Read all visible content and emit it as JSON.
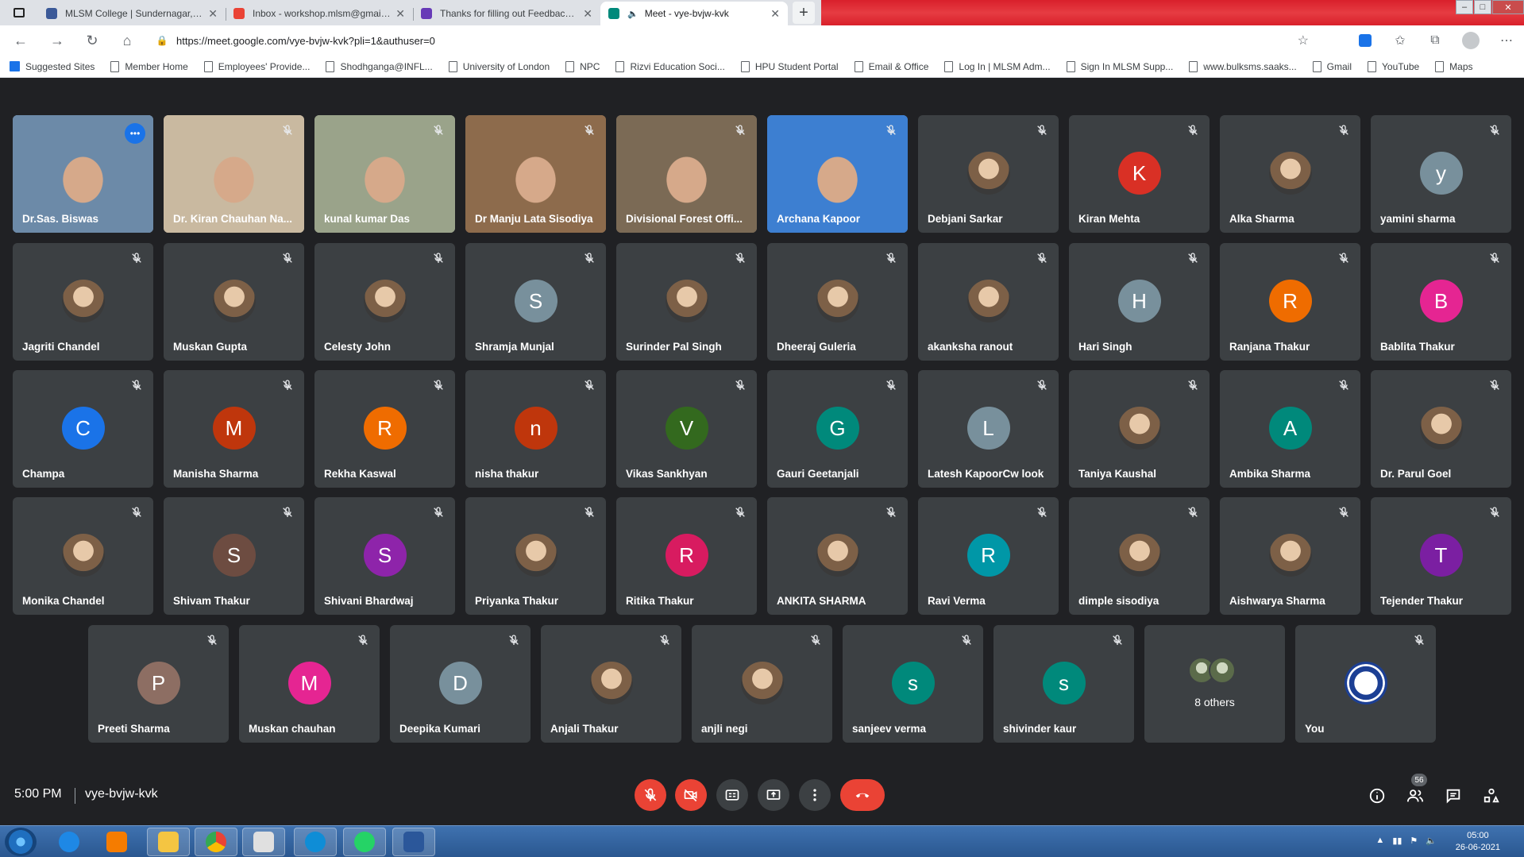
{
  "tabs": [
    {
      "title": "MLSM College | Sundernagar, Mandi",
      "favicon_color": "#3b5998",
      "active": false
    },
    {
      "title": "Inbox - workshop.mlsm@gmail.com",
      "favicon_color": "#ea4335",
      "active": false
    },
    {
      "title": "Thanks for filling out Feedback form",
      "favicon_color": "#673ab7",
      "active": false
    },
    {
      "title": "Meet - vye-bvjw-kvk",
      "favicon_color": "#00897b",
      "active": true
    }
  ],
  "address": {
    "url": "https://meet.google.com/vye-bvjw-kvk?pli=1&authuser=0"
  },
  "bookmarks": [
    {
      "label": "Suggested Sites",
      "icon": "apps-icon"
    },
    {
      "label": "Member Home",
      "icon": "page-icon"
    },
    {
      "label": "Employees' Provide...",
      "icon": "page-icon"
    },
    {
      "label": "Shodhganga@INFL...",
      "icon": "page-icon"
    },
    {
      "label": "University of London",
      "icon": "page-icon"
    },
    {
      "label": "NPC",
      "icon": "page-icon"
    },
    {
      "label": "Rizvi Education Soci...",
      "icon": "page-icon"
    },
    {
      "label": "HPU Student Portal",
      "icon": "page-icon"
    },
    {
      "label": "Email & Office",
      "icon": "page-icon"
    },
    {
      "label": "Log In | MLSM Adm...",
      "icon": "page-icon"
    },
    {
      "label": "Sign In MLSM Supp...",
      "icon": "page-icon"
    },
    {
      "label": "www.bulksms.saaks...",
      "icon": "page-icon"
    },
    {
      "label": "Gmail",
      "icon": "page-icon"
    },
    {
      "label": "YouTube",
      "icon": "page-icon"
    },
    {
      "label": "Maps",
      "icon": "page-icon"
    }
  ],
  "participants": [
    {
      "name": "Dr.Sas. Biswas",
      "type": "video",
      "speaking": true,
      "bg": "#6c8aa8"
    },
    {
      "name": "Dr. Kiran Chauhan Na...",
      "type": "video",
      "bg": "#c9b9a0"
    },
    {
      "name": "kunal kumar Das",
      "type": "video",
      "bg": "#9aa38a"
    },
    {
      "name": "Dr Manju Lata Sisodiya",
      "type": "video",
      "bg": "#8d6b4c"
    },
    {
      "name": "Divisional Forest Offi...",
      "type": "video",
      "bg": "#7b6a55"
    },
    {
      "name": "Archana Kapoor",
      "type": "video",
      "bg": "#3d7fd1"
    },
    {
      "name": "Debjani Sarkar",
      "type": "photo"
    },
    {
      "name": "Kiran Mehta",
      "type": "letter",
      "initial": "K",
      "color": "#d93025"
    },
    {
      "name": "Alka Sharma",
      "type": "photo"
    },
    {
      "name": "yamini sharma",
      "type": "letter",
      "initial": "y",
      "color": "#78909c"
    },
    {
      "name": "Jagriti Chandel",
      "type": "photo"
    },
    {
      "name": "Muskan Gupta",
      "type": "photo"
    },
    {
      "name": "Celesty John",
      "type": "photo"
    },
    {
      "name": "Shramja Munjal",
      "type": "letter",
      "initial": "S",
      "color": "#78909c"
    },
    {
      "name": "Surinder Pal Singh",
      "type": "photo"
    },
    {
      "name": "Dheeraj Guleria",
      "type": "photo"
    },
    {
      "name": "akanksha ranout",
      "type": "photo"
    },
    {
      "name": "Hari Singh",
      "type": "letter",
      "initial": "H",
      "color": "#78909c"
    },
    {
      "name": "Ranjana Thakur",
      "type": "letter",
      "initial": "R",
      "color": "#ef6c00"
    },
    {
      "name": "Bablita Thakur",
      "type": "letter",
      "initial": "B",
      "color": "#e52592"
    },
    {
      "name": "Champa",
      "type": "letter",
      "initial": "C",
      "color": "#1a73e8"
    },
    {
      "name": "Manisha Sharma",
      "type": "letter",
      "initial": "M",
      "color": "#bf360c"
    },
    {
      "name": "Rekha Kaswal",
      "type": "letter",
      "initial": "R",
      "color": "#ef6c00"
    },
    {
      "name": "nisha thakur",
      "type": "letter",
      "initial": "n",
      "color": "#bf360c"
    },
    {
      "name": "Vikas Sankhyan",
      "type": "letter",
      "initial": "V",
      "color": "#33691e"
    },
    {
      "name": "Gauri Geetanjali",
      "type": "letter",
      "initial": "G",
      "color": "#00897b"
    },
    {
      "name": "Latesh KapoorCw look",
      "type": "letter",
      "initial": "L",
      "color": "#78909c"
    },
    {
      "name": "Taniya Kaushal",
      "type": "photo"
    },
    {
      "name": "Ambika Sharma",
      "type": "letter",
      "initial": "A",
      "color": "#00897b"
    },
    {
      "name": "Dr. Parul Goel",
      "type": "photo"
    },
    {
      "name": "Monika Chandel",
      "type": "photo"
    },
    {
      "name": "Shivam Thakur",
      "type": "letter",
      "initial": "S",
      "color": "#6d4c41"
    },
    {
      "name": "Shivani Bhardwaj",
      "type": "letter",
      "initial": "S",
      "color": "#8e24aa"
    },
    {
      "name": "Priyanka Thakur",
      "type": "photo"
    },
    {
      "name": "Ritika Thakur",
      "type": "letter",
      "initial": "R",
      "color": "#d81b60"
    },
    {
      "name": "ANKITA SHARMA",
      "type": "photo"
    },
    {
      "name": "Ravi Verma",
      "type": "letter",
      "initial": "R",
      "color": "#0097a7"
    },
    {
      "name": "dimple sisodiya",
      "type": "photo"
    },
    {
      "name": "Aishwarya Sharma",
      "type": "photo"
    },
    {
      "name": "Tejender Thakur",
      "type": "letter",
      "initial": "T",
      "color": "#7b1fa2"
    },
    {
      "name": "Preeti Sharma",
      "type": "letter",
      "initial": "P",
      "color": "#8d6e63"
    },
    {
      "name": "Muskan chauhan",
      "type": "letter",
      "initial": "M",
      "color": "#e52592"
    },
    {
      "name": "Deepika Kumari",
      "type": "letter",
      "initial": "D",
      "color": "#78909c"
    },
    {
      "name": "Anjali Thakur",
      "type": "photo"
    },
    {
      "name": "anjli negi",
      "type": "photo"
    },
    {
      "name": "sanjeev verma",
      "type": "letter",
      "initial": "s",
      "color": "#00897b"
    },
    {
      "name": "shivinder kaur",
      "type": "letter",
      "initial": "s",
      "color": "#00897b"
    },
    {
      "name": "",
      "type": "others",
      "others_label": "8 others"
    },
    {
      "name": "You",
      "type": "you"
    }
  ],
  "footer": {
    "time": "5:00 PM",
    "meeting_code": "vye-bvjw-kvk",
    "participant_count": "56"
  },
  "taskbar": {
    "time": "05:00",
    "date": "26-06-2021"
  }
}
